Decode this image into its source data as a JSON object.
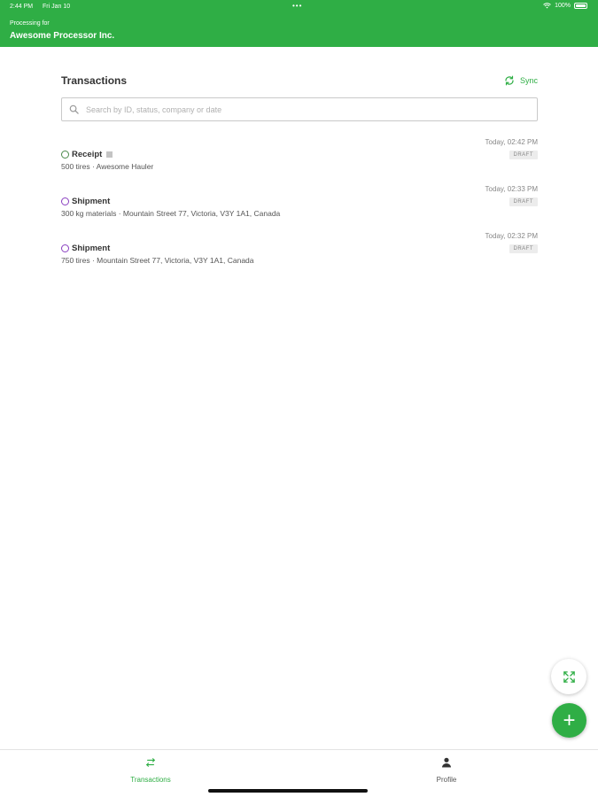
{
  "status_bar": {
    "time": "2:44 PM",
    "date": "Fri Jan 10",
    "battery": "100%"
  },
  "header": {
    "subtitle": "Processing for",
    "title": "Awesome Processor Inc."
  },
  "page": {
    "title": "Transactions",
    "sync_label": "Sync"
  },
  "search": {
    "placeholder": "Search by ID, status, company or date"
  },
  "transactions": [
    {
      "type": "Receipt",
      "detail": "500 tires · Awesome Hauler",
      "time": "Today, 02:42 PM",
      "status": "DRAFT"
    },
    {
      "type": "Shipment",
      "detail": "300 kg materials · Mountain Street 77, Victoria, V3Y 1A1, Canada",
      "time": "Today, 02:33 PM",
      "status": "DRAFT"
    },
    {
      "type": "Shipment",
      "detail": "750 tires · Mountain Street 77, Victoria, V3Y 1A1, Canada",
      "time": "Today, 02:32 PM",
      "status": "DRAFT"
    }
  ],
  "tabs": [
    {
      "label": "Transactions",
      "icon": "transactions-icon",
      "active": true
    },
    {
      "label": "Profile",
      "icon": "person-icon",
      "active": false
    }
  ],
  "colors": {
    "brand": "#2fae45",
    "receipt": "#4a8a4a",
    "shipment": "#8a3fc0"
  }
}
